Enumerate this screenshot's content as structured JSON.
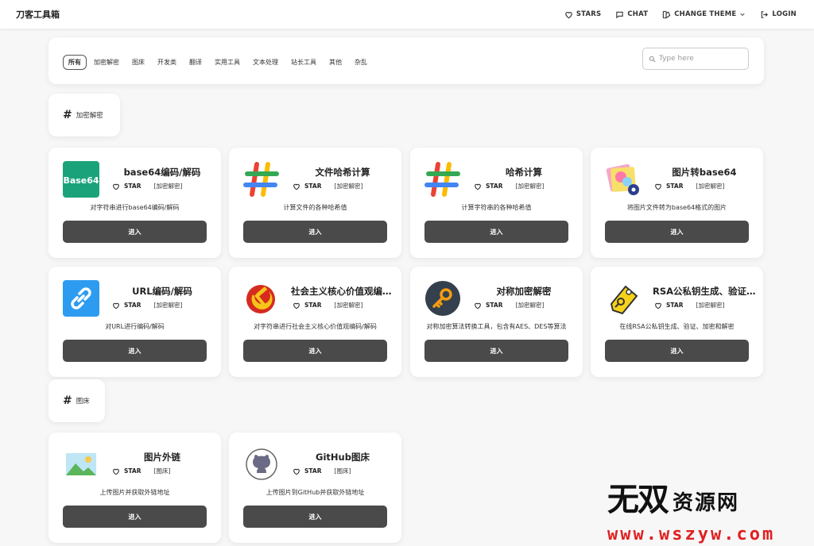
{
  "navbar": {
    "brand": "刀客工具箱",
    "stars": "STARS",
    "chat": "CHAT",
    "theme": "CHANGE THEME",
    "login": "LOGIN"
  },
  "filter": {
    "tabs": [
      "所有",
      "加密解密",
      "图床",
      "开发类",
      "翻译",
      "实用工具",
      "文本处理",
      "站长工具",
      "其他",
      "杂乱"
    ],
    "active_tab": "所有",
    "search_placeholder": "Type here",
    "search_value": ""
  },
  "sections": [
    {
      "title": "加密解密",
      "tools": [
        {
          "name": "base64编码/解码",
          "tag": "[加密解密]",
          "desc": "对字符串进行base64编码/解码",
          "icon": "base64-icon"
        },
        {
          "name": "文件哈希计算",
          "tag": "[加密解密]",
          "desc": "计算文件的各种哈希值",
          "icon": "hash-icon"
        },
        {
          "name": "哈希计算",
          "tag": "[加密解密]",
          "desc": "计算字符串的各种哈希值",
          "icon": "hash-icon"
        },
        {
          "name": "图片转base64",
          "tag": "[加密解密]",
          "desc": "将图片文件转为base64格式的图片",
          "icon": "image-convert-icon"
        },
        {
          "name": "URL编码/解码",
          "tag": "[加密解密]",
          "desc": "对URL进行编码/解码",
          "icon": "link-icon"
        },
        {
          "name": "社会主义核心价值观编码/解码",
          "tag": "[加密解密]",
          "desc": "对字符串进行社会主义核心价值观编码/解码",
          "icon": "hammer-sickle-icon"
        },
        {
          "name": "对称加密解密",
          "tag": "[加密解密]",
          "desc": "对称加密算法转换工具，包含有AES、DES等算法",
          "icon": "key-icon"
        },
        {
          "name": "RSA公私钥生成、验证、加密和解密",
          "tag": "[加密解密]",
          "desc": "在线RSA公私钥生成、验证、加密和解密",
          "icon": "key-tag-icon"
        }
      ]
    },
    {
      "title": "图床",
      "tools": [
        {
          "name": "图片外链",
          "tag": "[图床]",
          "desc": "上传图片并获取外链地址",
          "icon": "landscape-image-icon"
        },
        {
          "name": "GitHub图床",
          "tag": "[图床]",
          "desc": "上传图片到GitHub并获取外链地址",
          "icon": "github-icon"
        }
      ]
    }
  ],
  "labels": {
    "star": "STAR",
    "enter": "进入",
    "hash": "#"
  },
  "watermark": {
    "line1_big": "无双",
    "line1_small": "资源网",
    "line2": "www.wszyw.com"
  },
  "colors": {
    "button_bg": "#4a4a4a",
    "watermark_url": "#e02020"
  }
}
